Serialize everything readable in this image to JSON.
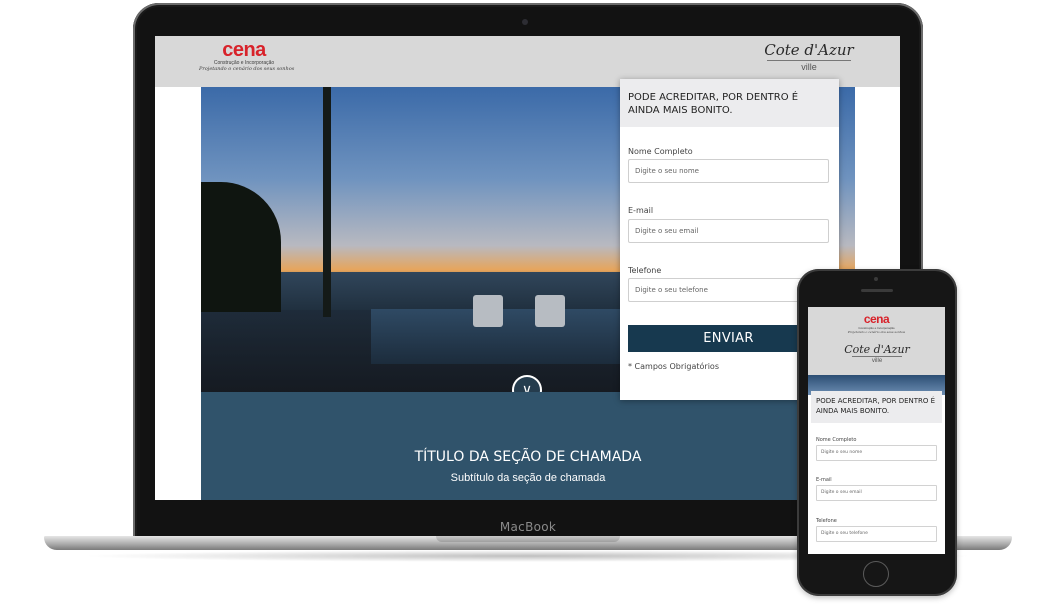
{
  "device": {
    "laptop_brand": "MacBook"
  },
  "header": {
    "cena_logo": {
      "name": "cena",
      "subtitle": "Construção e Incorporação",
      "tagline": "Projetando o cenário dos seus sonhos"
    },
    "cote_logo": {
      "name": "Cote d'Azur",
      "sub": "ville"
    }
  },
  "hero": {
    "scroll_icon": "chevron-down-icon",
    "scroll_glyph": "∨"
  },
  "callout": {
    "title": "TÍTULO DA SEÇÃO DE CHAMADA",
    "subtitle": "Subtítulo da seção de chamada"
  },
  "form": {
    "heading": "PODE ACREDITAR, POR DENTRO É AINDA MAIS BONITO.",
    "fields": [
      {
        "label": "Nome Completo",
        "placeholder": "Digite o seu nome"
      },
      {
        "label": "E-mail",
        "placeholder": "Digite o seu email"
      },
      {
        "label": "Telefone",
        "placeholder": "Digite o seu telefone"
      }
    ],
    "submit_label": "ENVIAR",
    "required_note": "* Campos Obrigatórios"
  },
  "colors": {
    "accent_dark": "#17394f",
    "callout_bg": "#30536b",
    "brand_red": "#d8222a",
    "header_bg": "#d8d8d8"
  }
}
